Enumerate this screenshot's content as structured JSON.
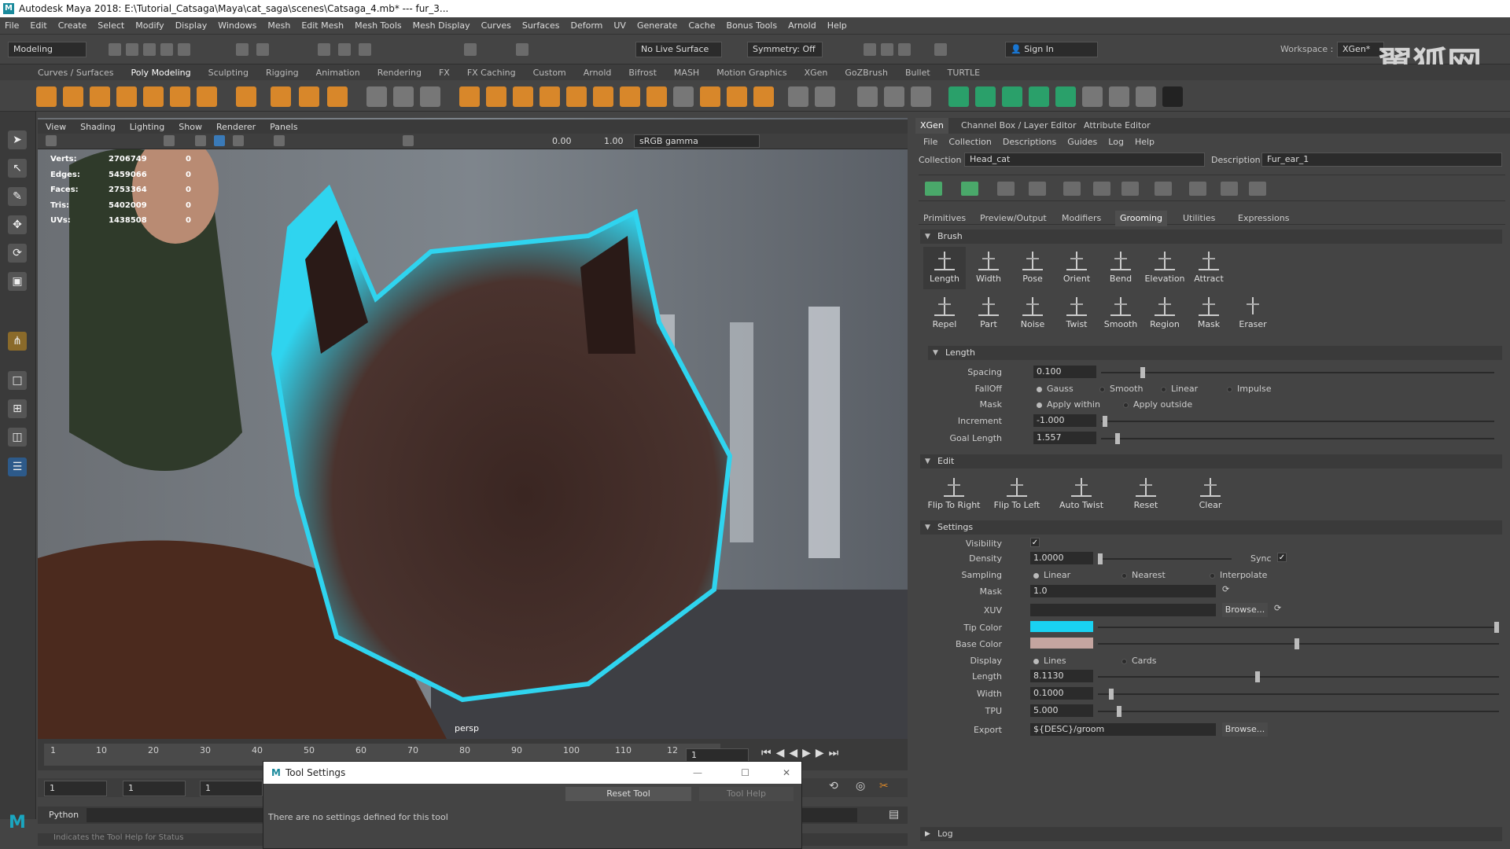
{
  "title": "Autodesk Maya 2018: E:\\Tutorial_Catsaga\\Maya\\cat_saga\\scenes\\Catsaga_4.mb* --- fur_3...",
  "menu": [
    "File",
    "Edit",
    "Create",
    "Select",
    "Modify",
    "Display",
    "Windows",
    "Mesh",
    "Edit Mesh",
    "Mesh Tools",
    "Mesh Display",
    "Curves",
    "Surfaces",
    "Deform",
    "UV",
    "Generate",
    "Cache",
    "Bonus Tools",
    "Arnold",
    "Help"
  ],
  "status": {
    "mode": "Modeling",
    "live_surface": "No Live Surface",
    "symmetry": "Symmetry: Off",
    "sign_in": "Sign In",
    "workspace_label": "Workspace :",
    "workspace_value": "XGen*"
  },
  "shelf_tabs": [
    "Curves / Surfaces",
    "Poly Modeling",
    "Sculpting",
    "Rigging",
    "Animation",
    "Rendering",
    "FX",
    "FX Caching",
    "Custom",
    "Arnold",
    "Bifrost",
    "MASH",
    "Motion Graphics",
    "XGen",
    "GoZBrush",
    "Bullet",
    "TURTLE"
  ],
  "viewport": {
    "menu": [
      "View",
      "Shading",
      "Lighting",
      "Show",
      "Renderer",
      "Panels"
    ],
    "exposure": "0.00",
    "gamma": "1.00",
    "color_space": "sRGB gamma",
    "camera": "persp",
    "hud": {
      "labels": [
        "Verts:",
        "Edges:",
        "Faces:",
        "Tris:",
        "UVs:"
      ],
      "values": [
        "2706749",
        "5459066",
        "2753364",
        "5402009",
        "1438508"
      ],
      "zeros": [
        "0",
        "0",
        "0",
        "0",
        "0"
      ]
    }
  },
  "timeline": {
    "ticks": [
      "1",
      "10",
      "20",
      "30",
      "40",
      "50",
      "60",
      "70",
      "80",
      "90",
      "100",
      "110",
      "12"
    ],
    "current": "1",
    "range_start": "1",
    "range_inner": "1",
    "range_anim": "1"
  },
  "cmd": {
    "lang": "Python",
    "help": "Indicates the Tool Help for Status"
  },
  "tool_settings": {
    "title": "Tool Settings",
    "reset": "Reset Tool",
    "help": "Tool Help",
    "message": "There are no settings defined for this tool"
  },
  "xgen": {
    "panel_tabs": [
      "XGen",
      "Channel Box / Layer Editor",
      "Attribute Editor"
    ],
    "menu": [
      "File",
      "Collection",
      "Descriptions",
      "Guides",
      "Log",
      "Help"
    ],
    "collection_label": "Collection",
    "collection": "Head_cat",
    "description_label": "Description",
    "description": "Fur_ear_1",
    "tabs": [
      "Primitives",
      "Preview/Output",
      "Modifiers",
      "Grooming",
      "Utilities",
      "Expressions"
    ],
    "brush_section": "Brush",
    "brushes_row1": [
      "Length",
      "Width",
      "Pose",
      "Orient",
      "Bend",
      "Elevation",
      "Attract"
    ],
    "brushes_row2": [
      "Repel",
      "Part",
      "Noise",
      "Twist",
      "Smooth",
      "Region",
      "Mask",
      "Eraser"
    ],
    "length_section": "Length",
    "spacing_label": "Spacing",
    "spacing": "0.100",
    "falloff_label": "FallOff",
    "falloff_options": [
      "Gauss",
      "Smooth",
      "Linear",
      "Impulse"
    ],
    "mask_label": "Mask",
    "mask_options": [
      "Apply within",
      "Apply outside"
    ],
    "increment_label": "Increment",
    "increment": "-1.000",
    "goal_label": "Goal Length",
    "goal": "1.557",
    "edit_section": "Edit",
    "edit_buttons": [
      "Flip To Right",
      "Flip To Left",
      "Auto Twist",
      "Reset",
      "Clear"
    ],
    "settings_section": "Settings",
    "visibility_label": "Visibility",
    "density_label": "Density",
    "density": "1.0000",
    "sync_label": "Sync",
    "sampling_label": "Sampling",
    "sampling_options": [
      "Linear",
      "Nearest",
      "Interpolate"
    ],
    "mask2_label": "Mask",
    "mask2": "1.0",
    "xuv_label": "XUV",
    "browse": "Browse...",
    "tip_label": "Tip Color",
    "tip_color": "#19d2f2",
    "base_label": "Base Color",
    "base_color": "#c4a5a0",
    "display_label": "Display",
    "display_options": [
      "Lines",
      "Cards"
    ],
    "len_label": "Length",
    "len": "8.1130",
    "width_label": "Width",
    "width": "0.1000",
    "tpu_label": "TPU",
    "tpu": "5.000",
    "export_label": "Export",
    "export": "${DESC}/groom",
    "log_section": "Log"
  },
  "watermark": "翼狐网"
}
